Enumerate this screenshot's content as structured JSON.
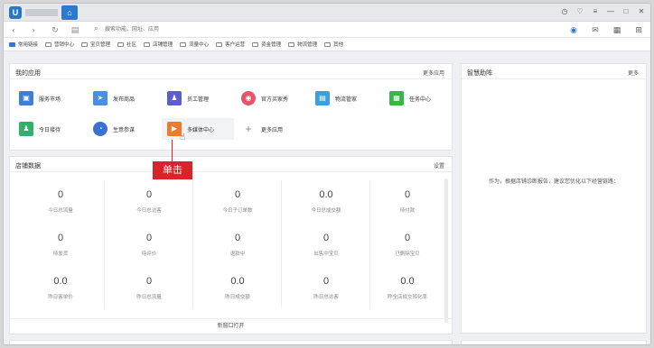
{
  "titlebar": {
    "logo": "U",
    "home_icon": "home-icon",
    "controls": [
      "clock-icon",
      "shield-icon",
      "menu-icon",
      "minimize-icon",
      "restore-icon",
      "close-icon"
    ],
    "control_glyphs": [
      "◷",
      "♡",
      "≡",
      "—",
      "□",
      "✕"
    ]
  },
  "navbar": {
    "back": "‹",
    "forward": "›",
    "reload": "↻",
    "page": "▤",
    "search_icon": "⌕",
    "address_placeholder": "搜索功能、网址、应用",
    "right_glyphs": [
      "◉",
      "✉",
      "▦",
      "⊞"
    ]
  },
  "bookmarks": [
    "常用链接",
    "营销中心",
    "宝贝管理",
    "社区",
    "店铺管理",
    "流量中心",
    "客户运营",
    "资金管理",
    "物流管理",
    "其他"
  ],
  "my_apps": {
    "title": "我的应用",
    "more": "更多应用",
    "row1": [
      {
        "label": "服务市场",
        "glyph": "▣",
        "color": "#3f7fd6"
      },
      {
        "label": "发布商品",
        "glyph": "➤",
        "color": "#4a8fe0"
      },
      {
        "label": "员工管理",
        "glyph": "♟",
        "color": "#5b5fc7"
      },
      {
        "label": "官方买家秀",
        "glyph": "◉",
        "color": "#e4546b"
      },
      {
        "label": "物流管家",
        "glyph": "▤",
        "color": "#3aa2d8"
      },
      {
        "label": "任务中心",
        "glyph": "▦",
        "color": "#39b54a"
      }
    ],
    "row2": [
      {
        "label": "今日接待",
        "glyph": "♟",
        "color": "#2fb36b"
      },
      {
        "label": "生意参谋",
        "glyph": "◔",
        "color": "#3b6fd1"
      },
      {
        "label": "多媒体中心",
        "glyph": "▶",
        "color": "#f07a2b"
      },
      {
        "label": "更多应用",
        "glyph": "+",
        "color": "#ffffff"
      }
    ]
  },
  "annotation": {
    "click_label": "单击"
  },
  "shop_data": {
    "title": "店铺数据",
    "settings": "设置",
    "stats": [
      {
        "value": "0",
        "label": "今日总流量"
      },
      {
        "value": "0",
        "label": "今日总访客"
      },
      {
        "value": "0",
        "label": "今日子订单数"
      },
      {
        "value": "0.0",
        "label": "今日总成交额"
      },
      {
        "value": "0",
        "label": "待付款"
      },
      {
        "value": "0",
        "label": "待发货"
      },
      {
        "value": "0",
        "label": "待评价"
      },
      {
        "value": "0",
        "label": "退款中"
      },
      {
        "value": "0",
        "label": "出售中宝贝"
      },
      {
        "value": "0",
        "label": "已删除宝贝"
      },
      {
        "value": "0.0",
        "label": "昨日客单价"
      },
      {
        "value": "0",
        "label": "昨日总流量"
      },
      {
        "value": "0.0",
        "label": "昨日成交额"
      },
      {
        "value": "0",
        "label": "昨日总访客"
      },
      {
        "value": "0.0",
        "label": "昨全店成交转化率"
      }
    ],
    "open_new": "新窗口打开"
  },
  "smart": {
    "title": "智慧助阵",
    "more": "更多",
    "message": "作为，根据店铺诊断报告，建议您优化以下经营链路："
  }
}
